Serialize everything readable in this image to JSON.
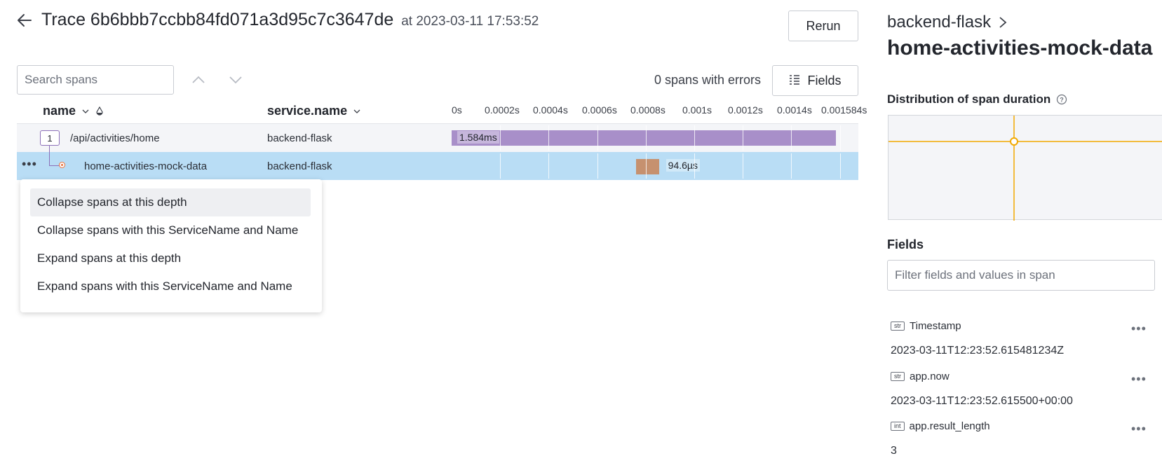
{
  "header": {
    "trace_title": "Trace 6b6bbb7ccbb84fd071a3d95c7c3647de",
    "trace_time": "at 2023-03-11 17:53:52",
    "rerun_label": "Rerun"
  },
  "toolbar": {
    "search_placeholder": "Search spans",
    "errors_text": "0 spans with errors",
    "fields_label": "Fields"
  },
  "columns": {
    "name": "name",
    "service": "service.name"
  },
  "timeline": {
    "ticks": [
      "0s",
      "0.0002s",
      "0.0004s",
      "0.0006s",
      "0.0008s",
      "0.001s",
      "0.0012s",
      "0.0014s",
      "0.001584s"
    ],
    "total_s": 0.001584
  },
  "spans": [
    {
      "name": "/api/activities/home",
      "service": "backend-flask",
      "child_count": "1",
      "duration_label": "1.584ms",
      "start_s": 0,
      "duration_s": 0.001584
    },
    {
      "name": "home-activities-mock-data",
      "service": "backend-flask",
      "duration_label": "94.6µs",
      "start_s": 0.00076,
      "duration_s": 9.46e-05
    }
  ],
  "context_menu": {
    "items": [
      "Collapse spans at this depth",
      "Collapse spans with this ServiceName and Name",
      "Expand spans at this depth",
      "Expand spans with this ServiceName and Name"
    ]
  },
  "panel": {
    "service": "backend-flask",
    "span_name": "home-activities-mock-data",
    "distribution_title": "Distribution of span duration",
    "fields_title": "Fields",
    "filter_placeholder": "Filter fields and values in span",
    "fields": [
      {
        "type": "str",
        "key": "Timestamp",
        "value": "2023-03-11T12:23:52.615481234Z"
      },
      {
        "type": "str",
        "key": "app.now",
        "value": "2023-03-11T12:23:52.615500+00:00"
      },
      {
        "type": "int",
        "key": "app.result_length",
        "value": "3"
      }
    ]
  },
  "colors": {
    "bar_root": "#a88fc9",
    "bar_child": "#c6916f",
    "selected_row": "#b9ddf5",
    "chart_accent": "#f2a900"
  }
}
